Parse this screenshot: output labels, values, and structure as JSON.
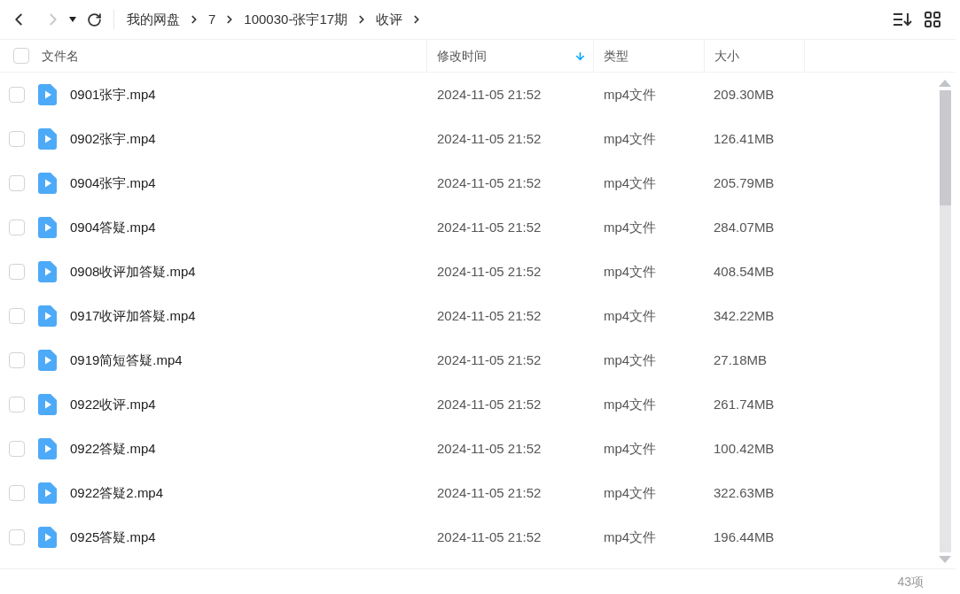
{
  "nav": {
    "back_disabled": false,
    "forward_disabled": true
  },
  "breadcrumb": [
    "我的网盘",
    "7",
    "100030-张宇17期",
    "收评"
  ],
  "header": {
    "select_all_checked": false
  },
  "columns": [
    {
      "label": "文件名",
      "sorted": false
    },
    {
      "label": "修改时间",
      "sorted": true
    },
    {
      "label": "类型",
      "sorted": false
    },
    {
      "label": "大小",
      "sorted": false
    }
  ],
  "rows": [
    {
      "name": "0901张宇.mp4",
      "modified": "2024-11-05 21:52",
      "type": "mp4文件",
      "size": "209.30MB",
      "checked": false
    },
    {
      "name": "0902张宇.mp4",
      "modified": "2024-11-05 21:52",
      "type": "mp4文件",
      "size": "126.41MB",
      "checked": false
    },
    {
      "name": "0904张宇.mp4",
      "modified": "2024-11-05 21:52",
      "type": "mp4文件",
      "size": "205.79MB",
      "checked": false
    },
    {
      "name": "0904答疑.mp4",
      "modified": "2024-11-05 21:52",
      "type": "mp4文件",
      "size": "284.07MB",
      "checked": false
    },
    {
      "name": "0908收评加答疑.mp4",
      "modified": "2024-11-05 21:52",
      "type": "mp4文件",
      "size": "408.54MB",
      "checked": false
    },
    {
      "name": "0917收评加答疑.mp4",
      "modified": "2024-11-05 21:52",
      "type": "mp4文件",
      "size": "342.22MB",
      "checked": false
    },
    {
      "name": "0919简短答疑.mp4",
      "modified": "2024-11-05 21:52",
      "type": "mp4文件",
      "size": "27.18MB",
      "checked": false
    },
    {
      "name": "0922收评.mp4",
      "modified": "2024-11-05 21:52",
      "type": "mp4文件",
      "size": "261.74MB",
      "checked": false
    },
    {
      "name": "0922答疑.mp4",
      "modified": "2024-11-05 21:52",
      "type": "mp4文件",
      "size": "100.42MB",
      "checked": false
    },
    {
      "name": "0922答疑2.mp4",
      "modified": "2024-11-05 21:52",
      "type": "mp4文件",
      "size": "322.63MB",
      "checked": false
    },
    {
      "name": "0925答疑.mp4",
      "modified": "2024-11-05 21:52",
      "type": "mp4文件",
      "size": "196.44MB",
      "checked": false
    }
  ],
  "status_bar": {
    "count": "43项"
  }
}
